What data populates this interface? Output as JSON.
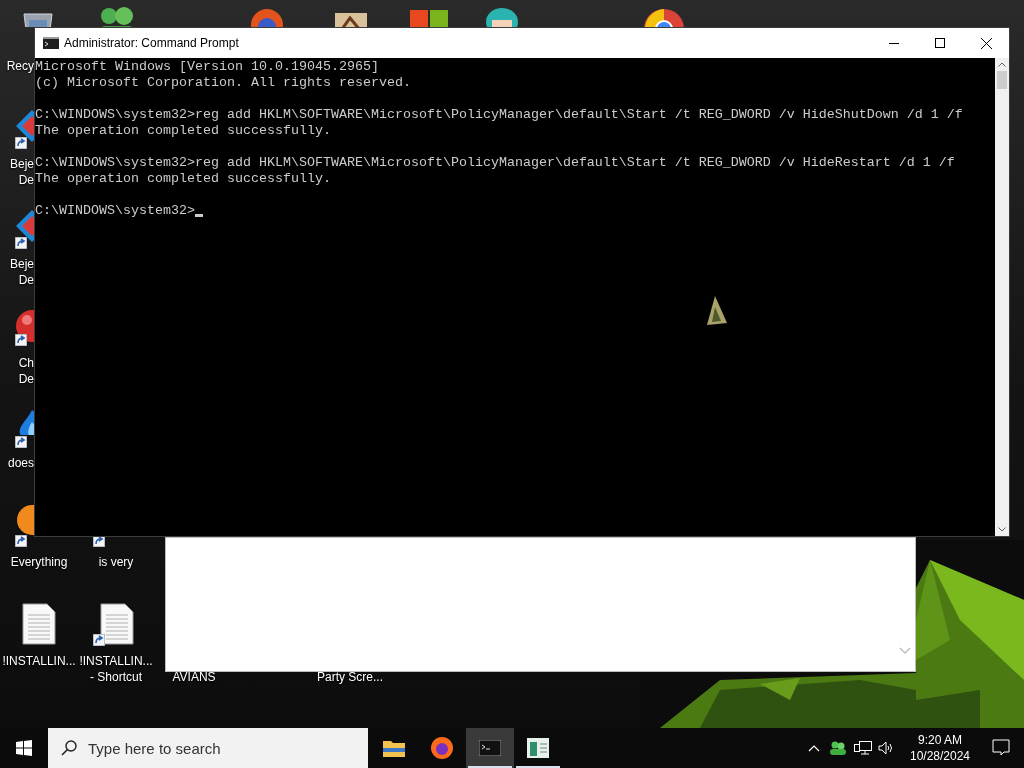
{
  "desktop": {
    "icons": [
      {
        "kind": "recycle",
        "shortcut": false,
        "label_lines": [
          "Recy"
        ]
      },
      {
        "kind": "gem",
        "shortcut": true,
        "label_lines": [
          "Beje",
          "De"
        ]
      },
      {
        "kind": "gem",
        "shortcut": true,
        "label_lines": [
          "Beje",
          "De"
        ]
      },
      {
        "kind": "ball",
        "shortcut": true,
        "label_lines": [
          "Ch",
          "De"
        ]
      },
      {
        "kind": "flame",
        "shortcut": true,
        "label_lines": [
          "does"
        ]
      },
      {
        "kind": "orange",
        "shortcut": true,
        "label_lines": [
          "Everything"
        ]
      },
      {
        "kind": "hidden",
        "shortcut": true,
        "label_lines": [
          "is very"
        ]
      },
      {
        "kind": "document",
        "shortcut": false,
        "label_lines": [
          "!INSTALLIN..."
        ]
      },
      {
        "kind": "document",
        "shortcut": true,
        "label_lines": [
          "!INSTALLIN...",
          "- Shortcut"
        ]
      },
      {
        "kind": "hidden",
        "shortcut": false,
        "label_lines": [
          "AVIANS"
        ]
      },
      {
        "kind": "hidden",
        "shortcut": false,
        "label_lines": [
          "Party Scre..."
        ]
      }
    ]
  },
  "window": {
    "title": "Administrator: Command Prompt",
    "blocks": [
      [
        "Microsoft Windows [Version 10.0.19045.2965]",
        "(c) Microsoft Corporation. All rights reserved."
      ],
      [
        "C:\\WINDOWS\\system32>reg add HKLM\\SOFTWARE\\Microsoft\\PolicyManager\\default\\Start /t REG_DWORD /v HideShutDown /d 1 /f",
        "The operation completed successfully."
      ],
      [
        "C:\\WINDOWS\\system32>reg add HKLM\\SOFTWARE\\Microsoft\\PolicyManager\\default\\Start /t REG_DWORD /v HideRestart /d 1 /f",
        "The operation completed successfully."
      ]
    ],
    "prompt": "C:\\WINDOWS\\system32>"
  },
  "taskbar": {
    "search": {
      "placeholder": "Type here to search"
    },
    "apps": [
      {
        "kind": "folder",
        "selected": false,
        "running": false
      },
      {
        "kind": "browser",
        "selected": false,
        "running": false
      },
      {
        "kind": "terminal",
        "selected": true,
        "running": true
      },
      {
        "kind": "sheet",
        "selected": false,
        "running": true
      }
    ],
    "clock": {
      "time": "9:20 AM",
      "date": "10/28/2024"
    }
  }
}
